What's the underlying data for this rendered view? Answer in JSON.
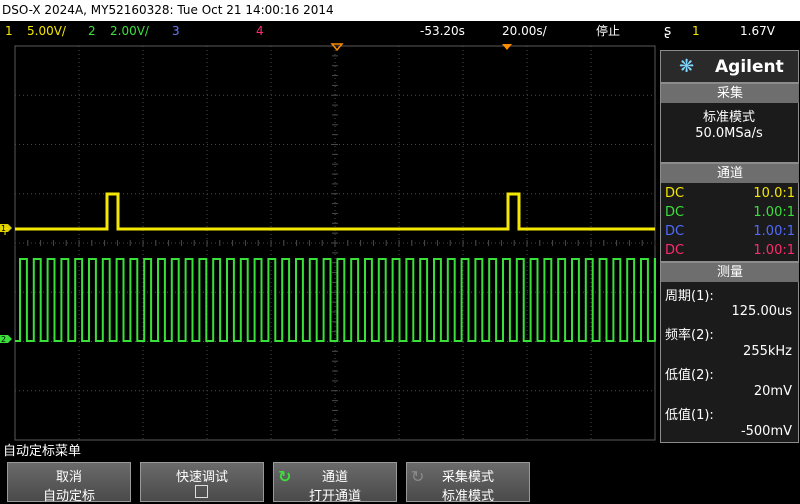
{
  "title_bar": "DSO-X 2024A, MY52160328: Tue Oct 21 14:00:16 2014",
  "status": {
    "ch1_num": "1",
    "ch1_scale": "5.00V/",
    "ch2_num": "2",
    "ch2_scale": "2.00V/",
    "ch3_num": "3",
    "ch4_num": "4",
    "time_offset": "-53.20s",
    "time_scale": "20.00s/",
    "run_state": "停止",
    "trigger_slope_icon": "rising-edge-icon",
    "trigger_source": "1",
    "trigger_level": "1.67V"
  },
  "brand": {
    "name": "Agilent"
  },
  "acquisition": {
    "header": "采集",
    "mode": "标准模式",
    "rate": "50.0MSa/s"
  },
  "channels": {
    "header": "通道",
    "rows": [
      {
        "coupling": "DC",
        "ratio": "10.0:1",
        "color": "#f5e800"
      },
      {
        "coupling": "DC",
        "ratio": "1.00:1",
        "color": "#3ae03a"
      },
      {
        "coupling": "DC",
        "ratio": "1.00:1",
        "color": "#4f6bff"
      },
      {
        "coupling": "DC",
        "ratio": "1.00:1",
        "color": "#ff2a6d"
      }
    ]
  },
  "measurements": {
    "header": "测量",
    "items": [
      {
        "label": "周期(1):",
        "value": "125.00us"
      },
      {
        "label": "频率(2):",
        "value": "255kHz"
      },
      {
        "label": "低值(2):",
        "value": "20mV"
      },
      {
        "label": "低值(1):",
        "value": "-500mV"
      }
    ]
  },
  "softkeys": {
    "menu_title": "自动定标菜单",
    "keys": [
      {
        "line1": "取消",
        "line2": "自动定标"
      },
      {
        "line1": "快速调试",
        "line2": ""
      },
      {
        "line1": "通道",
        "line2": "打开通道"
      },
      {
        "line1": "采集模式",
        "line2": "标准模式"
      }
    ]
  },
  "colors": {
    "ch1": "#f5e800",
    "ch2": "#3ae03a",
    "ch3": "#6a7cff",
    "ch4": "#ff2a6d",
    "grid": "#3c3c3c",
    "trigger_marker": "#ff8c00"
  }
}
